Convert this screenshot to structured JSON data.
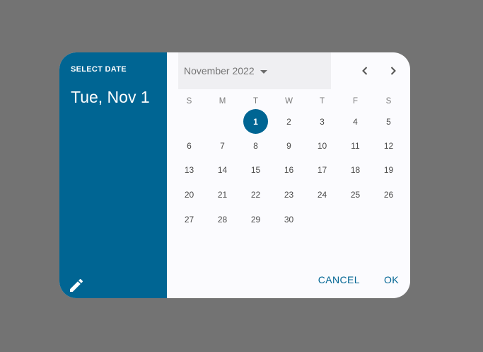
{
  "header": {
    "label": "SELECT DATE",
    "selected_date": "Tue, Nov 1",
    "edit_icon": "pencil-icon"
  },
  "picker": {
    "month_year": "November 2022",
    "dropdown_icon": "arrow-drop-down-icon",
    "prev_icon": "chevron-left-icon",
    "next_icon": "chevron-right-icon",
    "weekdays": [
      "S",
      "M",
      "T",
      "W",
      "T",
      "F",
      "S"
    ],
    "weeks": [
      [
        "",
        "",
        "1",
        "2",
        "3",
        "4",
        "5"
      ],
      [
        "6",
        "7",
        "8",
        "9",
        "10",
        "11",
        "12"
      ],
      [
        "13",
        "14",
        "15",
        "16",
        "17",
        "18",
        "19"
      ],
      [
        "20",
        "21",
        "22",
        "23",
        "24",
        "25",
        "26"
      ],
      [
        "27",
        "28",
        "29",
        "30",
        "",
        "",
        ""
      ]
    ],
    "selected_day": "1"
  },
  "actions": {
    "cancel_label": "CANCEL",
    "ok_label": "OK"
  },
  "colors": {
    "accent": "#006593",
    "backdrop": "#737373",
    "surface": "#fbfbfe"
  }
}
